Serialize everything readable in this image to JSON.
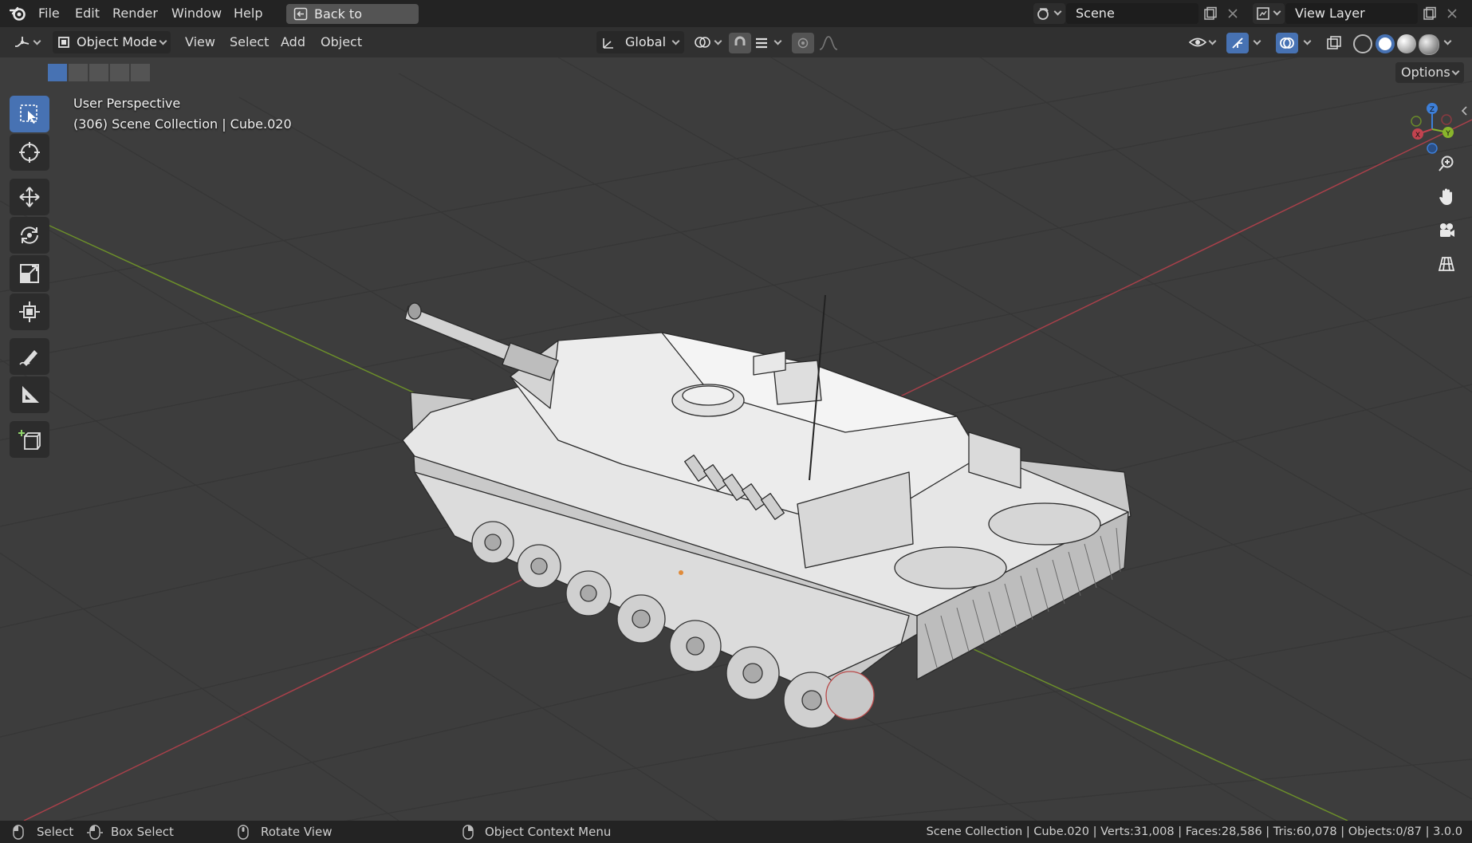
{
  "menubar": {
    "items": [
      "File",
      "Edit",
      "Render",
      "Window",
      "Help"
    ],
    "back_button": "Back to Previous",
    "scene_field": "Scene",
    "view_layer_field": "View Layer"
  },
  "header": {
    "mode": "Object Mode",
    "menus": [
      "View",
      "Select",
      "Add",
      "Object"
    ],
    "transform_orientation": "Global",
    "options": "Options"
  },
  "viewport": {
    "perspective_label": "User Perspective",
    "context_label": "(306) Scene Collection | Cube.020",
    "gizmo_axes": [
      "X",
      "Y",
      "Z"
    ]
  },
  "toolbar": {
    "tools": [
      "select-box",
      "cursor",
      "move",
      "rotate",
      "scale",
      "transform",
      "annotate",
      "measure",
      "add-cube"
    ],
    "active": "select-box"
  },
  "statusbar": {
    "select": "Select",
    "box_select": "Box Select",
    "rotate_view": "Rotate View",
    "context_menu": "Object Context Menu",
    "stats": "Scene Collection | Cube.020 | Verts:31,008 | Faces:28,586 | Tris:60,078 | Objects:0/87 | 3.0.0"
  },
  "colors": {
    "accent": "#4772b3",
    "x_axis": "#c2434f",
    "y_axis": "#89b52c",
    "z_axis": "#3d7fd9",
    "grid_bg": "#3d3d3d",
    "model_fill": "#d8d8d8"
  }
}
